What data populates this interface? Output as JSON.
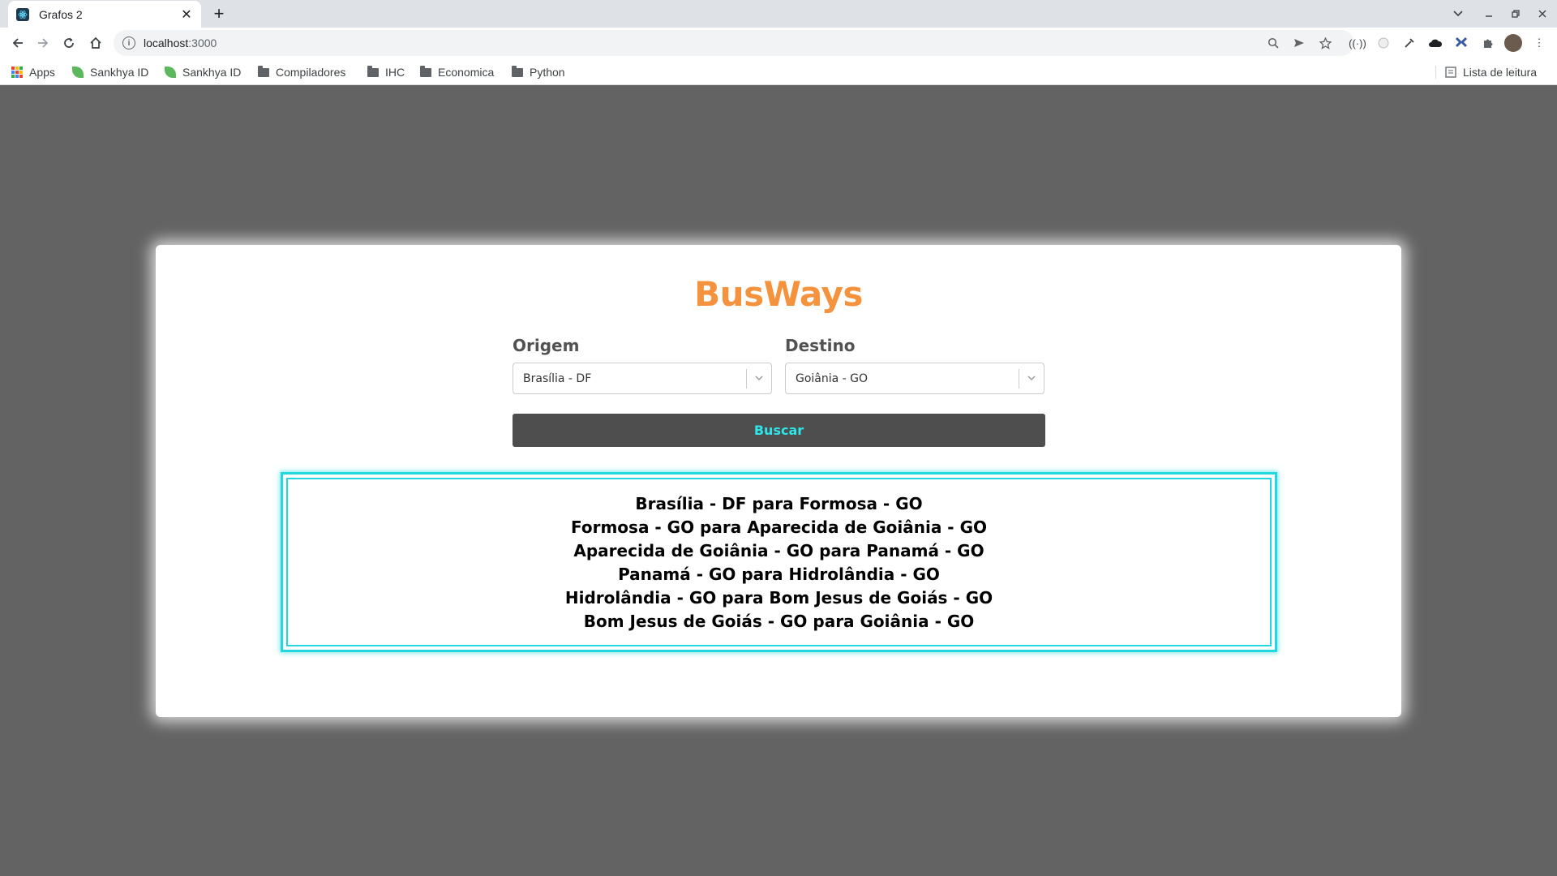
{
  "browser": {
    "tab_title": "Grafos 2",
    "tab_close": "✕",
    "new_tab": "+",
    "url_host": "localhost",
    "url_port": ":3000",
    "bookmarks": [
      {
        "label": "Apps",
        "icon": "apps-grid-icon"
      },
      {
        "label": "Sankhya ID",
        "icon": "sankhya-leaf-icon"
      },
      {
        "label": "Sankhya ID",
        "icon": "sankhya-leaf-icon"
      },
      {
        "label": "Compiladores",
        "icon": "folder-icon"
      },
      {
        "label": "IHC",
        "icon": "folder-icon"
      },
      {
        "label": "Economica",
        "icon": "folder-icon"
      },
      {
        "label": "Python",
        "icon": "folder-icon"
      }
    ],
    "reading_list": "Lista de leitura"
  },
  "app": {
    "logo": "BusWays",
    "origin": {
      "label": "Origem",
      "value": "Brasília - DF"
    },
    "destination": {
      "label": "Destino",
      "value": "Goiânia - GO"
    },
    "search_button": "Buscar",
    "routes": [
      "Brasília - DF para Formosa - GO",
      "Formosa - GO para Aparecida de Goiânia - GO",
      "Aparecida de Goiânia - GO para Panamá - GO",
      "Panamá - GO para Hidrolândia - GO",
      "Hidrolândia - GO para Bom Jesus de Goiás - GO",
      "Bom Jesus de Goiás - GO para Goiânia - GO"
    ]
  },
  "colors": {
    "logo": "#f5923e",
    "button_bg": "#4e4e4e",
    "button_text": "#2ee6ea",
    "result_border": "#22d8e0",
    "page_bg": "#636363"
  }
}
